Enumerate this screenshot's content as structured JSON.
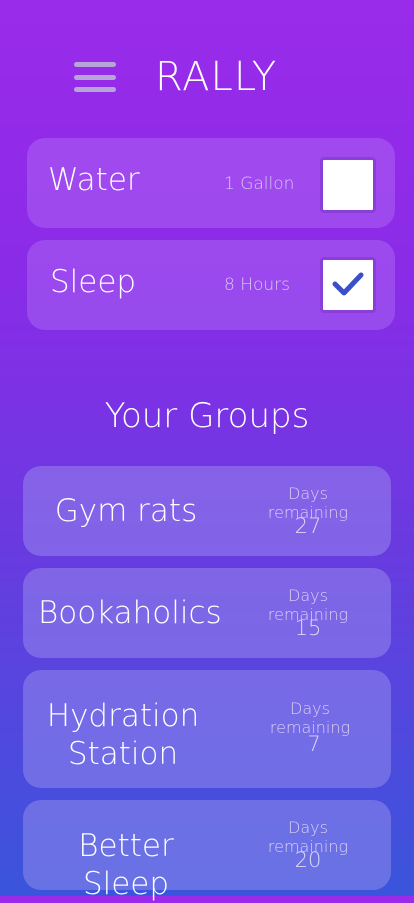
{
  "app": {
    "title": "RALLY"
  },
  "habits": [
    {
      "name": "Water",
      "amount": "1 Gallon",
      "checked": false
    },
    {
      "name": "Sleep",
      "amount": "8 Hours",
      "checked": true
    }
  ],
  "groups_title": "Your Groups",
  "groups": [
    {
      "name": "Gym rats",
      "days_label": "Days remaining",
      "days": "27"
    },
    {
      "name": "Bookaholics",
      "days_label": "Days remaining",
      "days": "15"
    },
    {
      "name": "Hydration Station",
      "days_label": "Days remaining",
      "days": "7"
    },
    {
      "name": "Better Sleep",
      "days_label": "Days remaining",
      "days": "20"
    }
  ],
  "colors": {
    "checkmark": "#3a4fc8",
    "checkbox_border": "#8a3fd8"
  }
}
